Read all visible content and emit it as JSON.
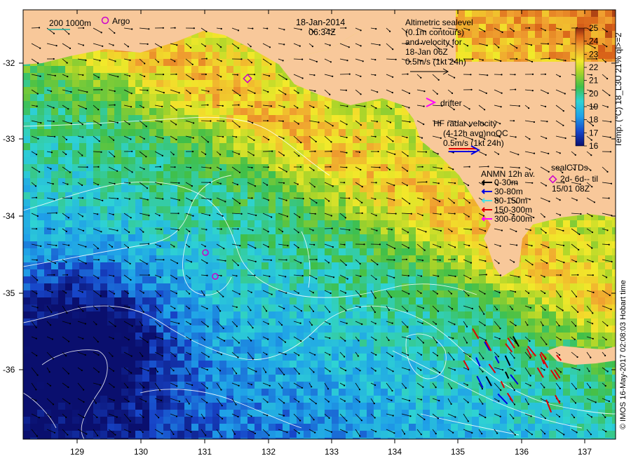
{
  "date": "18-Jan-2014",
  "time": "06:34Z",
  "scalebar_label": "200  1000m",
  "argo_label": "Argo",
  "altimetry": {
    "lines": [
      "Altimetric sealevel",
      "(0.1m contours)",
      "and velocity for",
      "18-Jan 06Z",
      "0.5m/s (1kt 24h)"
    ]
  },
  "drifter_label": "drifter",
  "hf_radar": {
    "lines": [
      "HF radar velocity",
      "(4-12h avg)noQC",
      "0.5m/s (1kt 24h)"
    ]
  },
  "anmn": {
    "title": "ANMN 12h av.",
    "items": [
      {
        "label": "0-30m",
        "color": "#000000"
      },
      {
        "label": "30-80m",
        "color": "#0000e0"
      },
      {
        "label": "80-150m",
        "color": "#50e0e0"
      },
      {
        "label": "150-300m",
        "color": "#e00000"
      },
      {
        "label": "300-600m",
        "color": "#ff00ff"
      }
    ]
  },
  "sealctd": {
    "title": "sealCTDs",
    "lines": [
      "2d- 6d-- til",
      "15/01 08Z"
    ]
  },
  "colorbar": {
    "label": "Temp. (°C) 18_L3U 21% ql>=2",
    "ticks": [
      "25",
      "24",
      "23",
      "22",
      "21",
      "20",
      "19",
      "18",
      "17",
      "16"
    ],
    "min": 16,
    "max": 25
  },
  "credit": "© IMOS 16-May-2017 02:08:03 Hobart time",
  "axes": {
    "x_ticks": [
      "129",
      "130",
      "131",
      "132",
      "133",
      "134",
      "135",
      "136",
      "137"
    ],
    "y_ticks": [
      "-32",
      "-33",
      "-34",
      "-35",
      "-36"
    ]
  },
  "colors": {
    "land": "#f8c89a",
    "argo": "#cc00cc",
    "drifter": "#ff00ff",
    "hf_arrow_red": "#e00000",
    "hf_arrow_blue": "#0000e0"
  }
}
